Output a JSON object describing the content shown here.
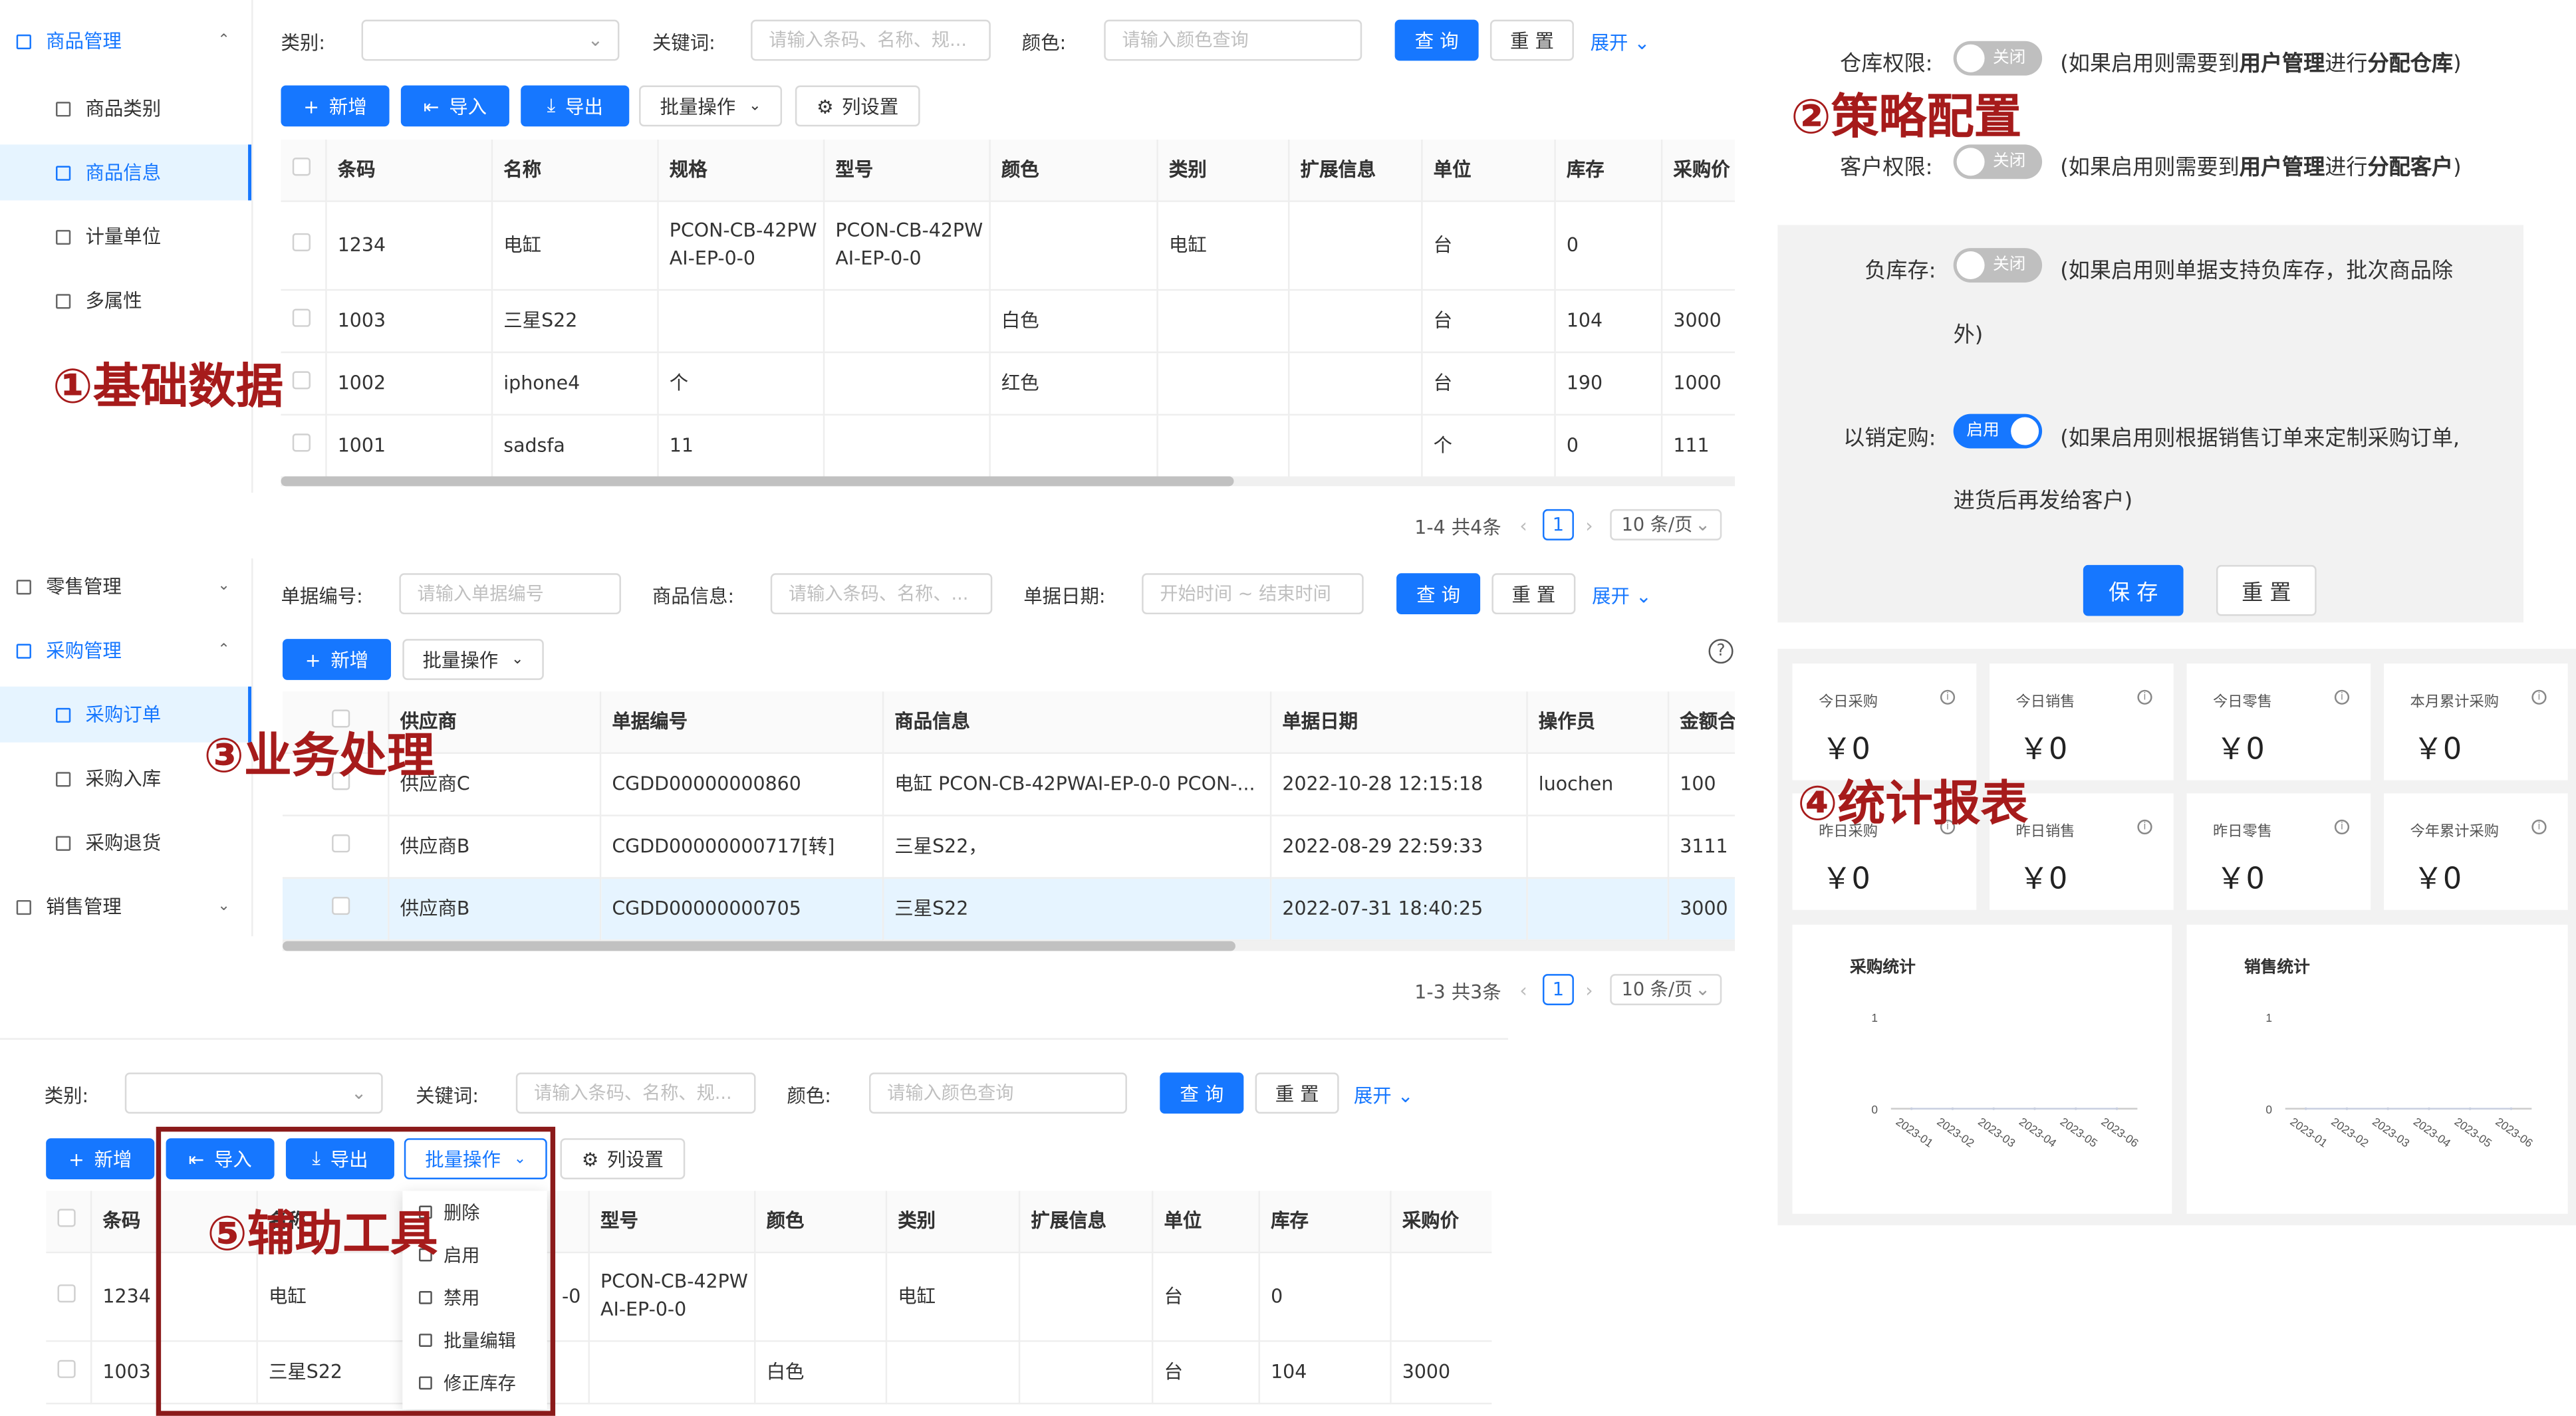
{
  "annotations": {
    "a1": "①基础数据",
    "a2": "②策略配置",
    "a3": "③业务处理",
    "a4": "④统计报表",
    "a5": "⑤辅助工具"
  },
  "menu1": {
    "group": "商品管理",
    "items": [
      "商品类别",
      "商品信息",
      "计量单位",
      "多属性"
    ]
  },
  "menu2": {
    "retail": "零售管理",
    "purchase": "采购管理",
    "items": [
      "采购订单",
      "采购入库",
      "采购退货"
    ],
    "sales": "销售管理"
  },
  "filter1": {
    "category_label": "类别:",
    "keyword_label": "关键词:",
    "keyword_ph": "请输入条码、名称、规...",
    "color_label": "颜色:",
    "color_ph": "请输入颜色查询",
    "query": "查 询",
    "reset": "重 置",
    "expand": "展开"
  },
  "toolbar1": {
    "add": "新增",
    "import": "导入",
    "export": "导出",
    "batch": "批量操作",
    "columns": "列设置"
  },
  "goods_table": {
    "headers": [
      "条码",
      "名称",
      "规格",
      "型号",
      "颜色",
      "类别",
      "扩展信息",
      "单位",
      "库存",
      "采购价"
    ],
    "rows": [
      [
        "1234",
        "电缸",
        "PCON-CB-42PWAI-EP-0-0",
        "PCON-CB-42PWAI-EP-0-0",
        "",
        "电缸",
        "",
        "台",
        "0",
        ""
      ],
      [
        "1003",
        "三星S22",
        "",
        "",
        "白色",
        "",
        "",
        "台",
        "104",
        "3000"
      ],
      [
        "1002",
        "iphone4",
        "个",
        "",
        "红色",
        "",
        "",
        "台",
        "190",
        "1000"
      ],
      [
        "1001",
        "sadsfa",
        "11",
        "",
        "",
        "",
        "",
        "个",
        "0",
        "111"
      ]
    ]
  },
  "pager1": {
    "total": "1-4 共4条",
    "page": "1",
    "size": "10 条/页"
  },
  "filter2": {
    "order_no_label": "单据编号:",
    "order_no_ph": "请输入单据编号",
    "goods_label": "商品信息:",
    "goods_ph": "请输入条码、名称、...",
    "date_label": "单据日期:",
    "date_ph": "开始时间 ~ 结束时间",
    "query": "查 询",
    "reset": "重 置",
    "expand": "展开"
  },
  "toolbar2": {
    "add": "新增",
    "batch": "批量操作"
  },
  "order_table": {
    "headers": [
      "供应商",
      "单据编号",
      "商品信息",
      "单据日期",
      "操作员",
      "金额合计"
    ],
    "rows": [
      [
        "供应商C",
        "CGDD00000000860",
        "电缸 PCON-CB-42PWAI-EP-0-0 PCON-...",
        "2022-10-28 12:15:18",
        "luochen",
        "100"
      ],
      [
        "供应商B",
        "CGDD00000000717[转]",
        "三星S22，",
        "2022-08-29 22:59:33",
        "",
        "3111"
      ],
      [
        "供应商B",
        "CGDD00000000705",
        "三星S22",
        "2022-07-31 18:40:25",
        "",
        "3000"
      ]
    ]
  },
  "pager2": {
    "total": "1-3 共3条",
    "page": "1",
    "size": "10 条/页"
  },
  "strategy": {
    "warehouse_label": "仓库权限:",
    "warehouse_state": "关闭",
    "warehouse_note_1": "(如果启用则需要到",
    "warehouse_note_b1": "用户管理",
    "warehouse_note_2": "进行",
    "warehouse_note_b2": "分配仓库",
    "warehouse_note_3": ")",
    "customer_label": "客户权限:",
    "customer_state": "关闭",
    "customer_note_1": "(如果启用则需要到",
    "customer_note_b1": "用户管理",
    "customer_note_2": "进行",
    "customer_note_b2": "分配客户",
    "customer_note_3": ")",
    "negative_label": "负库存:",
    "negative_state": "关闭",
    "negative_note": "(如果启用则单据支持负库存，批次商品除",
    "negative_note2": "外)",
    "sale_label": "以销定购:",
    "sale_state": "启用",
    "sale_note": "(如果启用则根据销售订单来定制采购订单,",
    "sale_note2": "进货后再发给客户)",
    "save": "保 存",
    "reset": "重 置"
  },
  "stats": {
    "cards": [
      {
        "label": "今日采购",
        "value": "￥0"
      },
      {
        "label": "今日销售",
        "value": "￥0"
      },
      {
        "label": "今日零售",
        "value": "￥0"
      },
      {
        "label": "本月累计采购",
        "value": "￥0"
      },
      {
        "label": "昨日采购",
        "value": "￥0"
      },
      {
        "label": "昨日销售",
        "value": "￥0"
      },
      {
        "label": "昨日零售",
        "value": "￥0"
      },
      {
        "label": "今年累计采购",
        "value": "￥0"
      }
    ]
  },
  "chart_data": [
    {
      "type": "line",
      "title": "采购统计",
      "x": [
        "2023-01",
        "2023-02",
        "2023-03",
        "2023-04",
        "2023-05",
        "2023-06"
      ],
      "ytick_labels": [
        "1",
        "0"
      ],
      "ylim": [
        0,
        1
      ],
      "series": [
        {
          "values": [
            0,
            0,
            0,
            0,
            0,
            0
          ]
        }
      ]
    },
    {
      "type": "line",
      "title": "销售统计",
      "x": [
        "2023-01",
        "2023-02",
        "2023-03",
        "2023-04",
        "2023-05",
        "2023-06"
      ],
      "ytick_labels": [
        "1",
        "0"
      ],
      "ylim": [
        0,
        1
      ],
      "series": [
        {
          "values": [
            0,
            0,
            0,
            0,
            0,
            0
          ]
        }
      ]
    }
  ],
  "filter3": {
    "category_label": "类别:",
    "keyword_label": "关键词:",
    "keyword_ph": "请输入条码、名称、规...",
    "color_label": "颜色:",
    "color_ph": "请输入颜色查询",
    "query": "查 询",
    "reset": "重 置",
    "expand": "展开"
  },
  "toolbar3": {
    "add": "新增",
    "import": "导入",
    "export": "导出",
    "batch": "批量操作",
    "columns": "列设置"
  },
  "batch_menu": [
    "删除",
    "启用",
    "禁用",
    "批量编辑",
    "修正库存"
  ],
  "goods_table2": {
    "headers": [
      "条码",
      "名称",
      "型号",
      "颜色",
      "类别",
      "扩展信息",
      "单位",
      "库存",
      "采购价"
    ],
    "rows": [
      [
        "1234",
        "电缸",
        "PCON-CB-42PWAI-EP-0-0",
        "",
        "电缸",
        "",
        "台",
        "0",
        ""
      ],
      [
        "1003",
        "三星S22",
        "",
        "白色",
        "",
        "",
        "台",
        "104",
        "3000"
      ]
    ]
  }
}
